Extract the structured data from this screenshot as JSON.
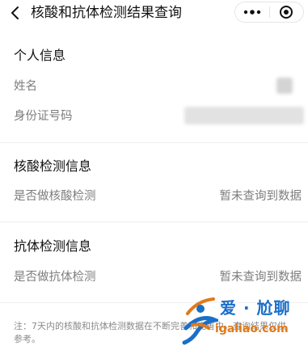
{
  "navbar": {
    "title": "核酸和抗体检测结果查询",
    "back_icon": "chevron-left-icon",
    "more_icon": "more-dots-icon",
    "close_icon": "miniprogram-close-icon"
  },
  "personal": {
    "title": "个人信息",
    "name_label": "姓名",
    "id_label": "身份证号码"
  },
  "nucleic": {
    "title": "核酸检测信息",
    "question": "是否做核酸检测",
    "answer": "暂未查询到数据"
  },
  "antibody": {
    "title": "抗体检测信息",
    "question": "是否做抗体检测",
    "answer": "暂未查询到数据"
  },
  "note": "注：7天内的核酸和抗体检测数据在不断完善和完善中，查询结果仅供参考。",
  "watermark": {
    "text": "爱 · 尬聊",
    "url": "igaliao.com",
    "colors": {
      "blue": "#1a6fc9",
      "orange": "#e07a1c"
    }
  }
}
